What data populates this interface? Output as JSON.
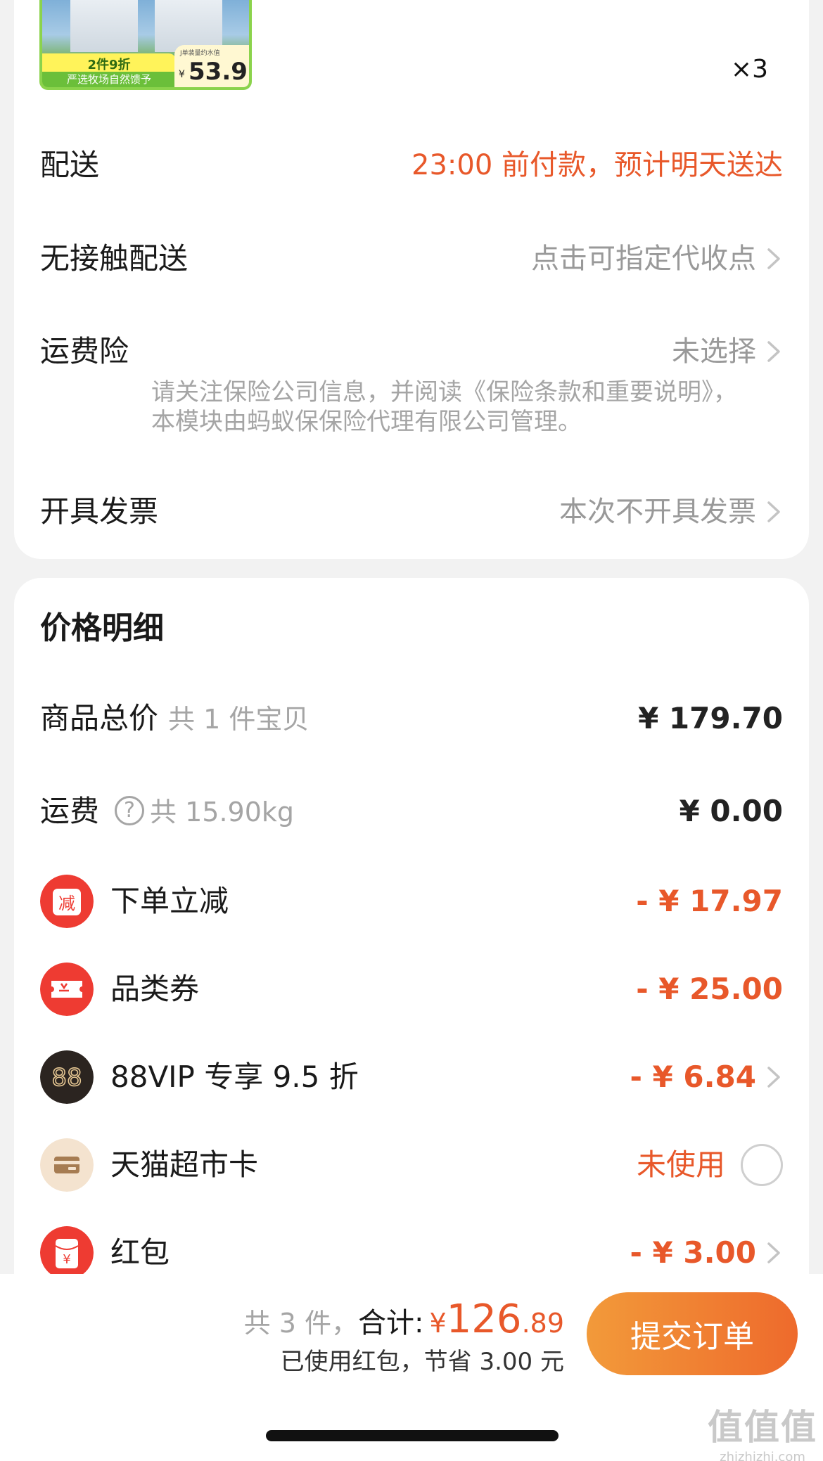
{
  "product": {
    "tag_line1": "2件9折",
    "tag_line2": "严选牧场自然馈予",
    "price_note": "J单装量约水值",
    "price_yen": "¥",
    "price": "53.9",
    "quantity": "×3"
  },
  "delivery": {
    "label": "配送",
    "value": "23:00 前付款，预计明天送达",
    "value_color": "#e8582a"
  },
  "contactless": {
    "label": "无接触配送",
    "value": "点击可指定代收点"
  },
  "insurance": {
    "label": "运费险",
    "value": "未选择",
    "note": "请关注保险公司信息，并阅读《保险条款和重要说明》，本模块由蚂蚁保保险代理有限公司管理。"
  },
  "invoice": {
    "label": "开具发票",
    "value": "本次不开具发票"
  },
  "price_detail": {
    "title": "价格明细",
    "goods_total": {
      "label": "商品总价",
      "sub": "共 1 件宝贝",
      "amount": "¥ 179.70"
    },
    "shipping": {
      "label": "运费",
      "help": "?",
      "sub": "共 15.90kg",
      "amount": "¥ 0.00"
    },
    "discounts": [
      {
        "label": "下单立减",
        "amount": "- ¥ 17.97",
        "icon": "reduce-icon",
        "icon_glyph": "减"
      },
      {
        "label": "品类券",
        "amount": "- ¥ 25.00",
        "icon": "coupon-icon"
      },
      {
        "label": "88VIP 专享 9.5 折",
        "amount": "- ¥ 6.84",
        "icon": "vip-88-icon",
        "icon_glyph": "88"
      },
      {
        "label": "天猫超市卡",
        "status": "未使用",
        "icon": "card-icon"
      },
      {
        "label": "红包",
        "amount": "- ¥ 3.00",
        "icon": "red-envelope-icon",
        "icon_glyph": "¥"
      }
    ]
  },
  "footer": {
    "count": "共 3 件，",
    "total_label": "合计:",
    "currency": "¥",
    "total_int": "126",
    "total_dec": ".89",
    "saving": "已使用红包，节省 3.00 元",
    "submit_label": "提交订单"
  },
  "watermark": {
    "line1": "值值值",
    "line2": "zhizhizhi.com"
  },
  "colors": {
    "accent": "#e8582a",
    "button_start": "#f29a3a",
    "button_end": "#ee6a2c"
  }
}
